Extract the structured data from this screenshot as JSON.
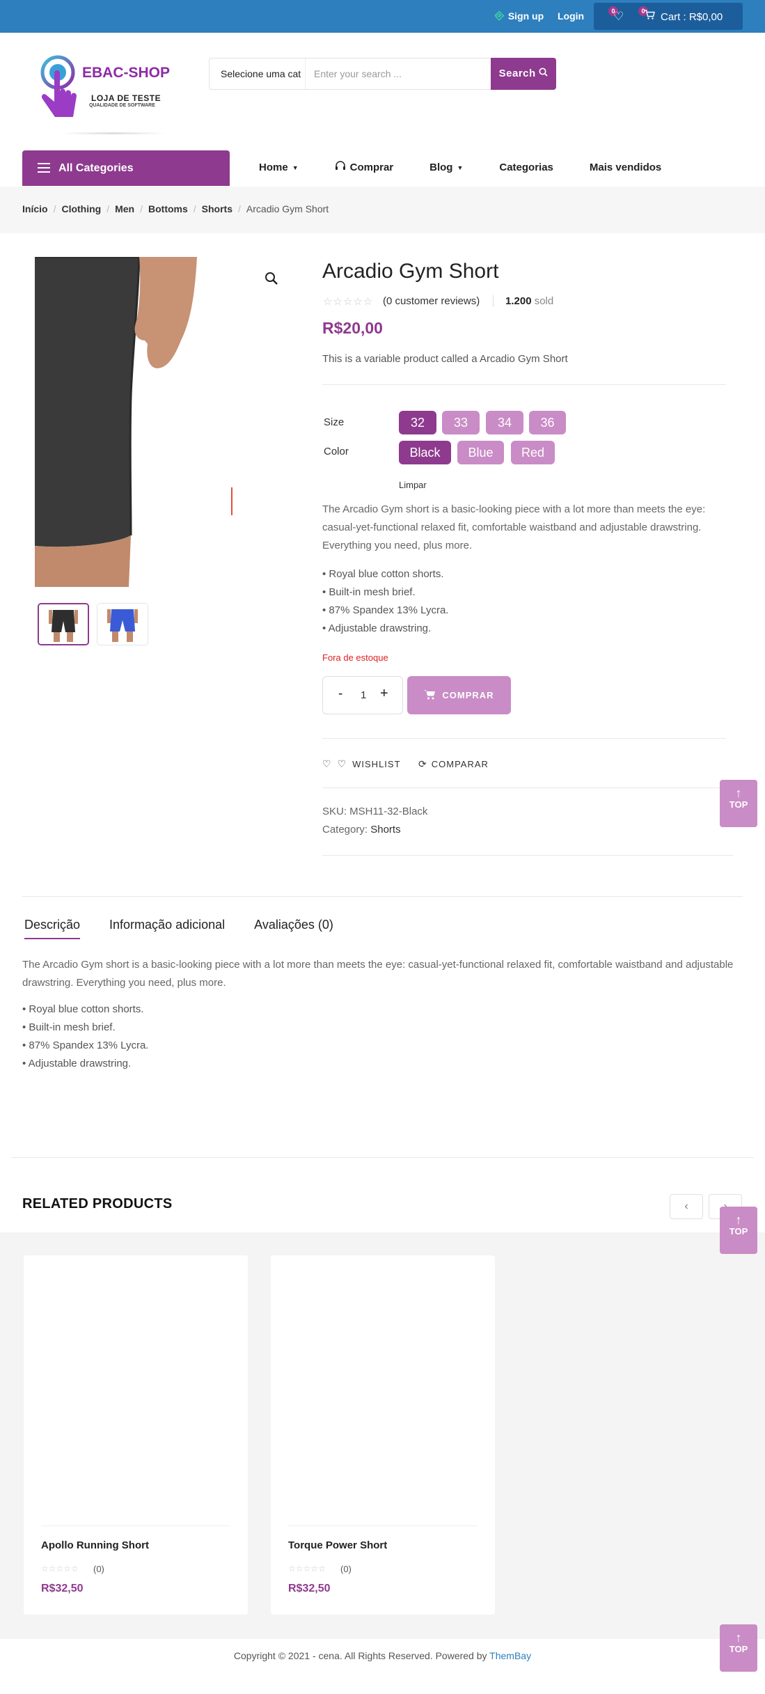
{
  "topbar": {
    "signup": "Sign up",
    "login": "Login",
    "wishlist_count": "0",
    "cart_count": "0",
    "cart_label": "Cart : R$0,00"
  },
  "header": {
    "brand": "EBAC-SHOP",
    "tagline": "LOJA DE TESTE",
    "tagline_sub": "QUALIDADE DE SOFTWARE",
    "search_category": "Selecione uma cat",
    "search_placeholder": "Enter your search ...",
    "search_button": "Search"
  },
  "nav": {
    "all_categories": "All Categories",
    "items": [
      "Home",
      "Comprar",
      "Blog",
      "Categorias",
      "Mais vendidos"
    ]
  },
  "breadcrumb": [
    "Início",
    "Clothing",
    "Men",
    "Bottoms",
    "Shorts",
    "Arcadio Gym Short"
  ],
  "product": {
    "title": "Arcadio Gym Short",
    "reviews": "(0 customer reviews)",
    "sold_count": "1.200",
    "sold_label": "sold",
    "price": "R$20,00",
    "short_description": "This is a variable product called a Arcadio Gym Short",
    "size_label": "Size",
    "sizes": [
      "32",
      "33",
      "34",
      "36"
    ],
    "color_label": "Color",
    "colors": [
      "Black",
      "Blue",
      "Red"
    ],
    "clear": "Limpar",
    "description": "The Arcadio Gym short is a basic-looking piece with a lot more than meets the eye: casual-yet-functional relaxed fit, comfortable waistband and adjustable drawstring. Everything you need, plus more.",
    "bullets": [
      "• Royal blue cotton shorts.",
      "• Built-in mesh brief.",
      "• 87% Spandex 13% Lycra.",
      "• Adjustable drawstring."
    ],
    "stock_status": "Fora de estoque",
    "qty_minus": "-",
    "quantity": "1",
    "qty_plus": "+",
    "buy_button": "COMPRAR",
    "wishlist": "WISHLIST",
    "compare": "COMPARAR",
    "sku": "SKU: MSH11-32-Black",
    "category_label": "Category:",
    "category_value": "Shorts"
  },
  "tabs": {
    "items": [
      "Descrição",
      "Informação adicional",
      "Avaliações (0)"
    ],
    "description": "The Arcadio Gym short is a basic-looking piece with a lot more than meets the eye: casual-yet-functional relaxed fit, comfortable waistband and adjustable drawstring. Everything you need, plus more.",
    "bullets": [
      "• Royal blue cotton shorts.",
      "• Built-in mesh brief.",
      "• 87% Spandex 13% Lycra.",
      "• Adjustable drawstring."
    ]
  },
  "related": {
    "heading": "RELATED PRODUCTS",
    "products": [
      {
        "name": "Apollo Running Short",
        "reviews": "(0)",
        "price": "R$32,50"
      },
      {
        "name": "Torque Power Short",
        "reviews": "(0)",
        "price": "R$32,50"
      }
    ]
  },
  "back_to_top": "TOP",
  "footer": {
    "copyright": "Copyright © 2021 - cena. All Rights Reserved. Powered by",
    "link": "ThemBay"
  },
  "colors": {
    "accent": "#8e3a8e",
    "accent_light": "#c98cc6",
    "topbar": "#2d7fbe",
    "out_of_stock": "#e02020"
  }
}
